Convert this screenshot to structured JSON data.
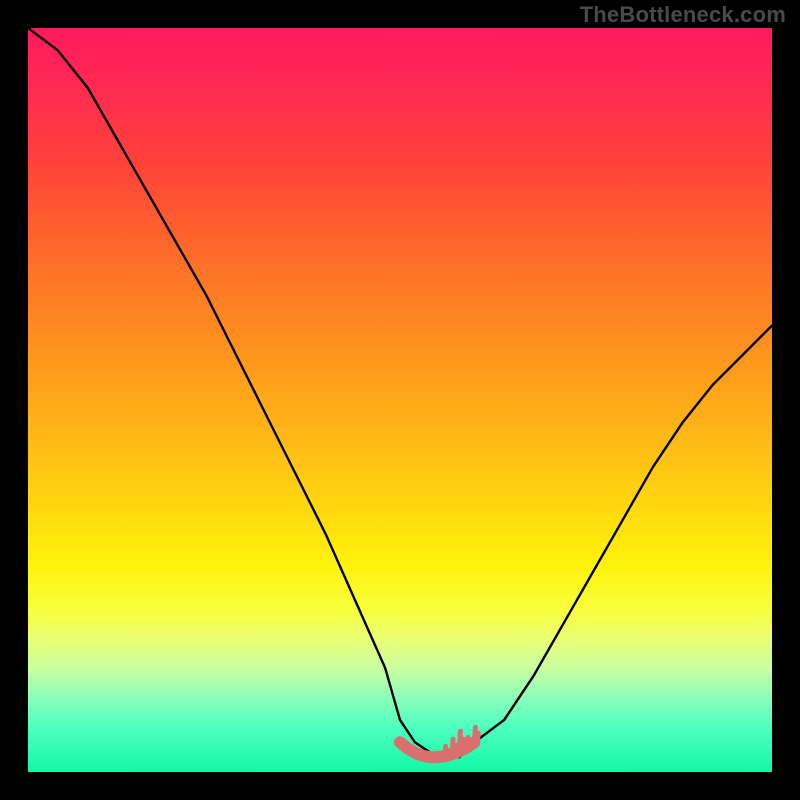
{
  "watermark": "TheBottleneck.com",
  "chart_data": {
    "type": "line",
    "title": "",
    "xlabel": "",
    "ylabel": "",
    "xlim": [
      0,
      100
    ],
    "ylim": [
      0,
      100
    ],
    "grid": false,
    "series": [
      {
        "name": "curve",
        "color": "#000000",
        "x": [
          0,
          4,
          8,
          12,
          16,
          20,
          24,
          28,
          32,
          36,
          40,
          44,
          48,
          50,
          52,
          55,
          58,
          60,
          64,
          68,
          72,
          76,
          80,
          84,
          88,
          92,
          96,
          100
        ],
        "values": [
          100,
          97,
          92,
          85,
          78,
          71,
          64,
          56,
          48,
          40,
          32,
          23,
          14,
          7,
          4,
          2,
          2,
          4,
          7,
          13,
          20,
          27,
          34,
          41,
          47,
          52,
          56,
          60
        ]
      },
      {
        "name": "highlight",
        "color": "#d9706e",
        "x": [
          50,
          51,
          52,
          53,
          54,
          55,
          56,
          57,
          58,
          59,
          60
        ],
        "values": [
          4,
          3.2,
          2.6,
          2.2,
          2.0,
          2.0,
          2.1,
          2.4,
          2.8,
          3.3,
          4.0
        ]
      }
    ],
    "annotations": []
  }
}
